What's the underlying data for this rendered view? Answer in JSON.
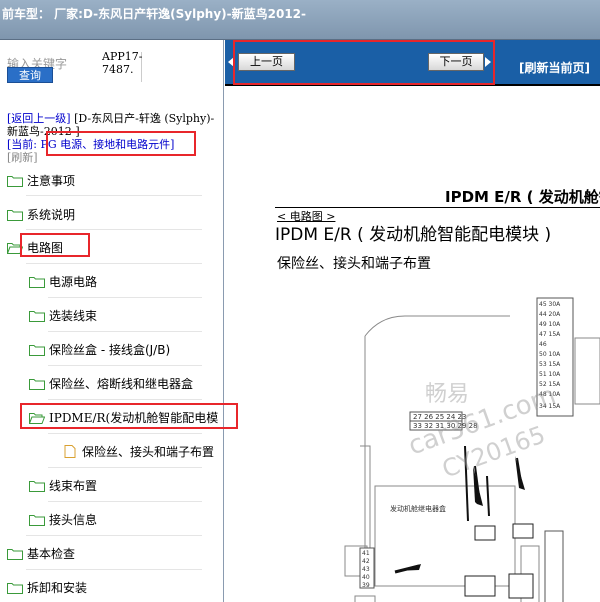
{
  "header": {
    "title": "前车型：   厂家:D-东风日产轩逸(Sylphy)-新蓝鸟2012-"
  },
  "search": {
    "placeholder": "输入关键字",
    "button_label": "查询",
    "app_code": "APP17-\n7487."
  },
  "breadcrumb": {
    "back_label": "[返回上一级]",
    "path_text": " [D-东风日产-轩逸 (Sylphy)-新蓝鸟-2012-]",
    "current_prefix": "[当前:",
    "current_value": " PG 电源、接地和电路元件]",
    "refresh_label": "[刷新]"
  },
  "tree": {
    "items": [
      {
        "label": "注意事项"
      },
      {
        "label": "系统说明"
      },
      {
        "label": "电路图"
      },
      {
        "label": "电源电路"
      },
      {
        "label": "选装线束"
      },
      {
        "label": "保险丝盒 - 接线盒(J/B)"
      },
      {
        "label": "保险丝、熔断线和继电器盒"
      },
      {
        "label": "IPDME/R(发动机舱智能配电模"
      },
      {
        "label": "保险丝、接头和端子布置"
      },
      {
        "label": "线束布置"
      },
      {
        "label": "接头信息"
      },
      {
        "label": "基本检查"
      },
      {
        "label": "拆卸和安装"
      }
    ]
  },
  "nav": {
    "prev_label": "上一页",
    "next_label": "下一页",
    "refresh_label": "[刷新当前页]"
  },
  "document": {
    "header_title": "IPDM E/R ( 发动机舱智",
    "tag": "< 电路图 >",
    "main_title": "IPDM E/R ( 发动机舱智能配电模块 )",
    "subtitle": "保险丝、接头和端子布置",
    "diagram_label": "发动机舱继电器盒",
    "watermark_1": "畅易",
    "watermark_2": "car361.com",
    "watermark_3": "CY20165",
    "fuse_block_1": [
      "45 30A",
      "44 20A",
      "49 10A",
      "47 15A",
      "46",
      "50 10A",
      "53 15A",
      "51 10A",
      "52 15A",
      "48 10A",
      "34 15A"
    ],
    "relay_numbers": [
      "27",
      "26",
      "25",
      "24",
      "23",
      "33",
      "32",
      "31",
      "30",
      "29",
      "28"
    ],
    "small_block": [
      "41",
      "42",
      "43",
      "40",
      "39"
    ]
  },
  "colors": {
    "accent": "#1a5fa6",
    "highlight": "#e8262b",
    "link": "#0000cc"
  }
}
